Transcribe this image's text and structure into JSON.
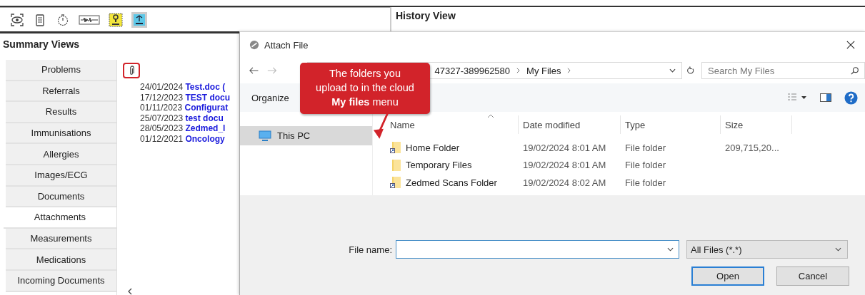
{
  "summary": {
    "title": "Summary Views",
    "items": [
      {
        "label": "Problems",
        "selected": false
      },
      {
        "label": "Referrals",
        "selected": false
      },
      {
        "label": "Results",
        "selected": false
      },
      {
        "label": "Immunisations",
        "selected": false
      },
      {
        "label": "Allergies",
        "selected": false
      },
      {
        "label": "Images/ECG",
        "selected": false
      },
      {
        "label": "Documents",
        "selected": false
      },
      {
        "label": "Attachments",
        "selected": true
      },
      {
        "label": "Measurements",
        "selected": false
      },
      {
        "label": "Medications",
        "selected": false
      },
      {
        "label": "Incoming Documents",
        "selected": false
      }
    ]
  },
  "attachments": [
    {
      "date": "24/01/2024",
      "title": "Test.doc ("
    },
    {
      "date": "17/12/2023",
      "title": "TEST docu"
    },
    {
      "date": "01/11/2023",
      "title": "Configurat"
    },
    {
      "date": "25/07/2023",
      "title": "test docu"
    },
    {
      "date": "28/05/2023",
      "title": "Zedmed_l"
    },
    {
      "date": "01/12/2021",
      "title": "Oncology"
    }
  ],
  "history": {
    "title": "History View"
  },
  "dialog": {
    "title": "Attach File",
    "address": [
      "47327-389962580",
      "My Files"
    ],
    "search": {
      "placeholder": "Search My Files"
    },
    "organize": "Organize",
    "nav": [
      {
        "label": "This PC",
        "selected": true
      }
    ],
    "columns": [
      "Name",
      "Date modified",
      "Type",
      "Size"
    ],
    "files": [
      {
        "name": "Home Folder",
        "date": "19/02/2024 8:01 AM",
        "type": "File folder",
        "size": "209,715,20...",
        "shortcut": true
      },
      {
        "name": "Temporary Files",
        "date": "19/02/2024 8:01 AM",
        "type": "File folder",
        "shortcut": false
      },
      {
        "name": "Zedmed Scans Folder",
        "date": "19/02/2024 8:02 AM",
        "type": "File folder",
        "shortcut": true
      }
    ],
    "file_name_label": "File name:",
    "filter": "All Files (*.*)",
    "buttons": [
      {
        "label": "Open",
        "default": true
      },
      {
        "label": "Cancel",
        "default": false
      }
    ]
  },
  "callout": {
    "text": "The folders you upload to in the cloud **My files** menu"
  }
}
